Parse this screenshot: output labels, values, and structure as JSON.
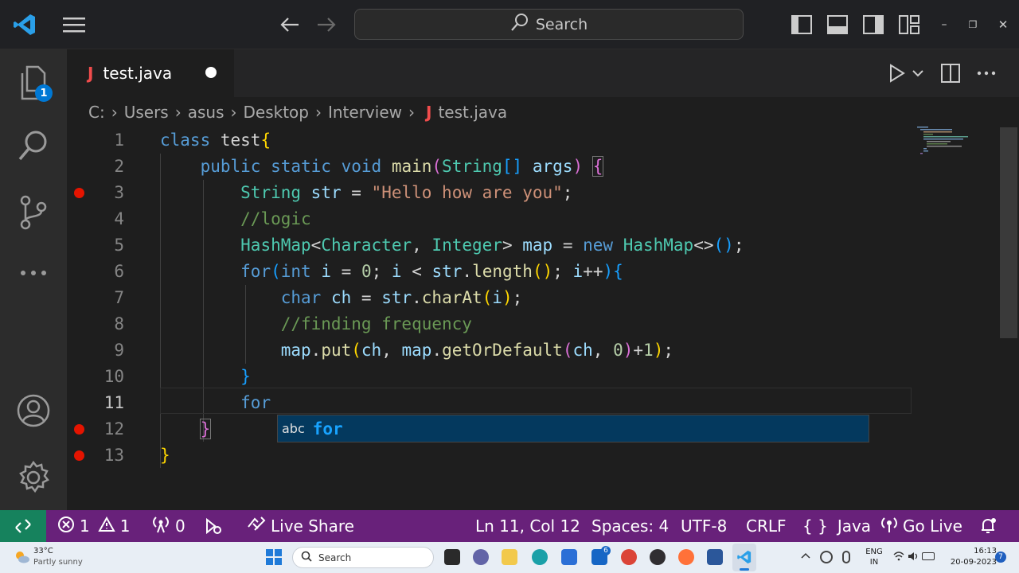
{
  "title_bar": {
    "search_label": "Search",
    "window_controls": {
      "minimize": "–",
      "restore": "❐",
      "close": "✕"
    }
  },
  "activity_bar": {
    "explorer_badge": "1"
  },
  "tab": {
    "label": "test.java",
    "icon_text": "J"
  },
  "breadcrumb": {
    "items": [
      "C:",
      "Users",
      "asus",
      "Desktop",
      "Interview",
      "test.java"
    ],
    "file_icon_text": "J"
  },
  "editor": {
    "line_numbers": [
      "1",
      "2",
      "3",
      "4",
      "5",
      "6",
      "7",
      "8",
      "9",
      "10",
      "11",
      "12",
      "13"
    ],
    "breakpoint_lines": [
      3,
      12,
      13
    ],
    "active_line": 11,
    "suggestion": {
      "kind": "abc",
      "label": "for"
    }
  },
  "status_bar": {
    "errors": "1",
    "warnings": "1",
    "ports": "0",
    "live_share": "Live Share",
    "position": "Ln 11, Col 12",
    "spaces": "Spaces: 4",
    "encoding": "UTF-8",
    "eol": "CRLF",
    "language": "Java",
    "go_live": "Go Live",
    "colors": {
      "background": "#68217a",
      "remote": "#16825d"
    }
  },
  "taskbar": {
    "weather_temp": "33°C",
    "weather_desc": "Partly sunny",
    "search_label": "Search",
    "lang_top": "ENG",
    "lang_bottom": "IN",
    "time": "16:13",
    "date": "20-09-2023",
    "mail_badge": "6",
    "notif_badge": "7"
  }
}
